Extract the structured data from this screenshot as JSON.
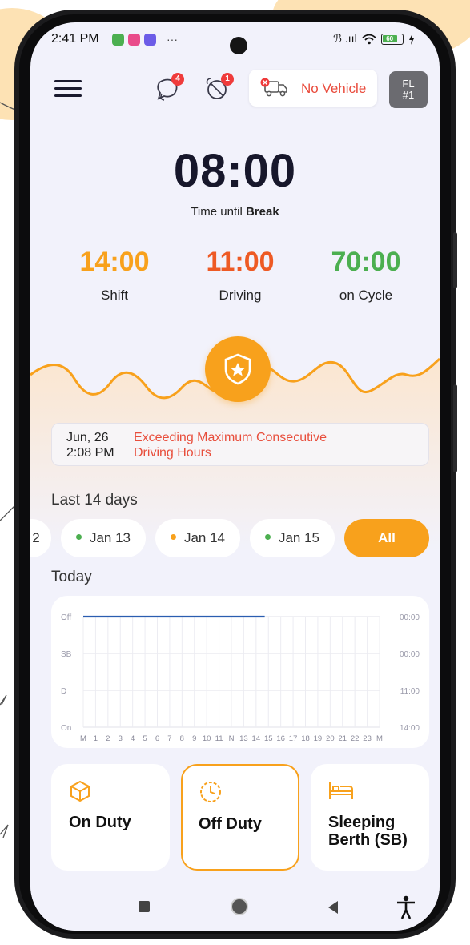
{
  "status_bar": {
    "time": "2:41 PM",
    "more": "···",
    "signal": "ℬ .ııl",
    "battery": "60"
  },
  "header": {
    "vehicle_label": "No Vehicle",
    "chat_badge": "4",
    "alert_badge": "1",
    "fl_line1": "FL",
    "fl_line2": "#1"
  },
  "timer": {
    "value": "08:00",
    "label_prefix": "Time until",
    "label_bold": "Break"
  },
  "stats": [
    {
      "value": "14:00",
      "label": "Shift",
      "color": "#f8a11c"
    },
    {
      "value": "11:00",
      "label": "Driving",
      "color": "#ee5a24"
    },
    {
      "value": "70:00",
      "label": "on Cycle",
      "color": "#4caf50"
    }
  ],
  "violation": {
    "date": "Jun, 26",
    "time": "2:08 PM",
    "message_line1": "Exceeding Maximum Consecutive",
    "message_line2": "Driving Hours"
  },
  "history": {
    "title": "Last 14 days",
    "chips": [
      {
        "label": "2",
        "dot_color": ""
      },
      {
        "label": "Jan 13",
        "dot_color": "#4caf50"
      },
      {
        "label": "Jan 14",
        "dot_color": "#f8a11c"
      },
      {
        "label": "Jan 15",
        "dot_color": "#4caf50"
      },
      {
        "label": "All",
        "dot_color": ""
      }
    ]
  },
  "today": {
    "title": "Today"
  },
  "chart_data": {
    "type": "line",
    "rows": [
      "Off",
      "SB",
      "D",
      "On"
    ],
    "row_totals": [
      "00:00",
      "00:00",
      "11:00",
      "14:00"
    ],
    "x_ticks": [
      "M",
      "1",
      "2",
      "3",
      "4",
      "5",
      "6",
      "7",
      "8",
      "9",
      "10",
      "11",
      "N",
      "13",
      "14",
      "15",
      "16",
      "17",
      "18",
      "19",
      "20",
      "21",
      "22",
      "23",
      "M"
    ],
    "series": [
      {
        "status": "Off",
        "start_hour": 0,
        "end_hour": 14.7
      }
    ],
    "line_color": "#2a5db0",
    "grid": true
  },
  "duty": [
    {
      "label": "On Duty",
      "icon": "cube-icon",
      "active": false
    },
    {
      "label": "Off Duty",
      "icon": "clock-icon",
      "active": true
    },
    {
      "label_line1": "Sleeping",
      "label_line2": "Berth (SB)",
      "icon": "bed-icon",
      "active": false
    }
  ],
  "colors": {
    "accent": "#f8a11c",
    "danger": "#e84e3c",
    "screen_bg": "#f2f2fb"
  }
}
